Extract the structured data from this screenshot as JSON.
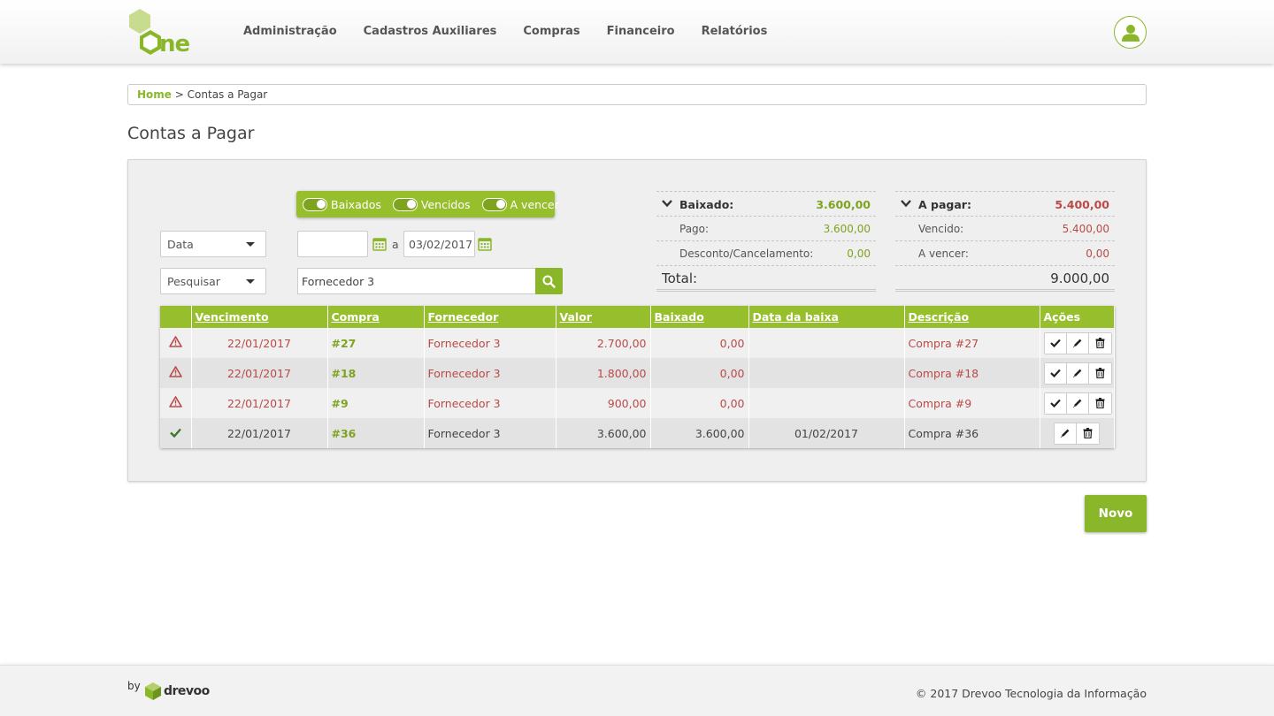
{
  "colors": {
    "accent": "#8ab72a",
    "danger": "#b94a48",
    "paid": "#3a7a2a"
  },
  "header": {
    "logo_text": "one",
    "nav": [
      "Administração",
      "Cadastros Auxiliares",
      "Compras",
      "Financeiro",
      "Relatórios"
    ],
    "avatar_icon": "user-icon"
  },
  "breadcrumb": {
    "home": "Home",
    "separator": ">",
    "current": "Contas a Pagar"
  },
  "page_title": "Contas a Pagar",
  "filters": {
    "toggles": [
      {
        "label": "Baixados",
        "on": true
      },
      {
        "label": "Vencidos",
        "on": true
      },
      {
        "label": "A vencer",
        "on": true
      }
    ],
    "date_field": "Data",
    "date_from": "",
    "date_sep": "a",
    "date_to": "03/02/2017",
    "search_field": "Pesquisar",
    "search_value": "Fornecedor 3"
  },
  "summary": {
    "baixado": {
      "label": "Baixado:",
      "value": "3.600,00"
    },
    "pago": {
      "label": "Pago:",
      "value": "3.600,00"
    },
    "desconto": {
      "label": "Desconto/Cancelamento:",
      "value": "0,00"
    },
    "apagar": {
      "label": "A pagar:",
      "value": "5.400,00"
    },
    "vencido": {
      "label": "Vencido:",
      "value": "5.400,00"
    },
    "avencer": {
      "label": "A vencer:",
      "value": "0,00"
    },
    "total_label": "Total:",
    "total_value": "9.000,00"
  },
  "table": {
    "headers": [
      "Vencimento",
      "Compra",
      "Fornecedor",
      "Valor",
      "Baixado",
      "Data da baixa",
      "Descrição",
      "Ações"
    ],
    "rows": [
      {
        "status": "warning-icon",
        "vencimento": "22/01/2017",
        "compra": "#27",
        "fornecedor": "Fornecedor 3",
        "valor": "2.700,00",
        "baixado": "0,00",
        "data_baixa": "",
        "descricao": "Compra #27"
      },
      {
        "status": "warning-icon",
        "vencimento": "22/01/2017",
        "compra": "#18",
        "fornecedor": "Fornecedor 3",
        "valor": "1.800,00",
        "baixado": "0,00",
        "data_baixa": "",
        "descricao": "Compra #18"
      },
      {
        "status": "warning-icon",
        "vencimento": "22/01/2017",
        "compra": "#9",
        "fornecedor": "Fornecedor 3",
        "valor": "900,00",
        "baixado": "0,00",
        "data_baixa": "",
        "descricao": "Compra #9"
      },
      {
        "status": "check-icon",
        "vencimento": "22/01/2017",
        "compra": "#36",
        "fornecedor": "Fornecedor 3",
        "valor": "3.600,00",
        "baixado": "3.600,00",
        "data_baixa": "01/02/2017",
        "descricao": "Compra #36"
      }
    ]
  },
  "novo_label": "Novo",
  "footer": {
    "by": "by",
    "brand": "drevoo",
    "copyright": "© 2017 Drevoo Tecnologia da Informação"
  }
}
